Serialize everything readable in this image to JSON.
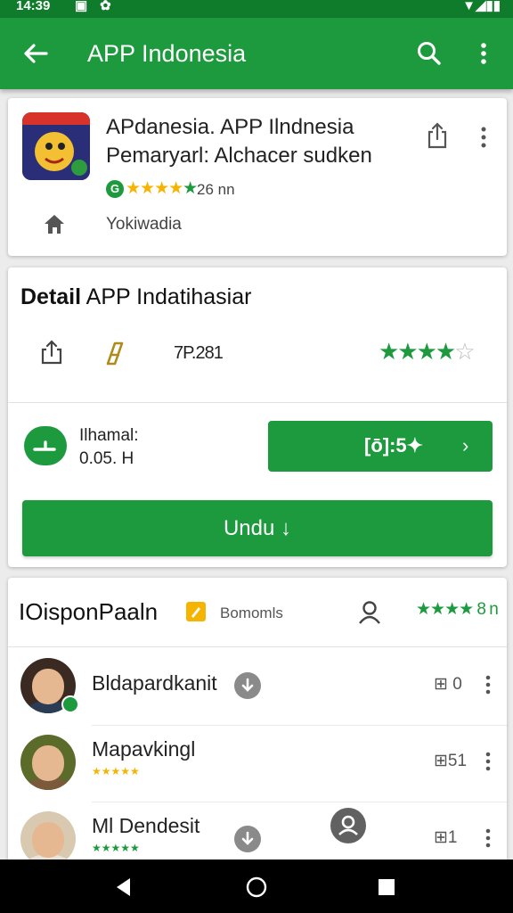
{
  "status_bar": {
    "time": "14:39"
  },
  "app_bar": {
    "title": "APP Indonesia"
  },
  "app_card": {
    "name_line1": "APdanesia. APP Ilndnesia",
    "name_line2": "Pemaryarl: Alchacer sudken",
    "rating_badge": "G",
    "size": "26 nn",
    "developer": "Yokiwadia",
    "rating": 4
  },
  "detail": {
    "title_bold": "Detail",
    "title_rest": " APP Indatihasiar",
    "code": "7P.281",
    "rating": 4,
    "info_label": "Ilhamal:",
    "info_value": "0.05. H",
    "action_label": "[ō]:5✦",
    "action_chevron": "›",
    "download_label": "Undu ↓"
  },
  "reviews": {
    "title": "IOisponPaaln",
    "filter": "Bomomls",
    "rating_text": "★★★★ 8 n",
    "items": [
      {
        "name": "Bldapardkanit",
        "count": "0",
        "verified": true
      },
      {
        "name": "Mapavkingl",
        "count": "51",
        "stars": "★★★★★"
      },
      {
        "name": "Ml Dendesit",
        "count": "1",
        "stars": "★★★★★"
      }
    ]
  },
  "colors": {
    "primary": "#1c9a3d",
    "status_bar": "#0f7c2c",
    "star_yellow": "#f5b400"
  },
  "icons": [
    "back-arrow-icon",
    "search-icon",
    "more-vert-icon",
    "share-icon",
    "home-icon",
    "tag-icon",
    "person-icon",
    "download-icon",
    "nav-back-icon",
    "nav-home-icon",
    "nav-recent-icon"
  ]
}
